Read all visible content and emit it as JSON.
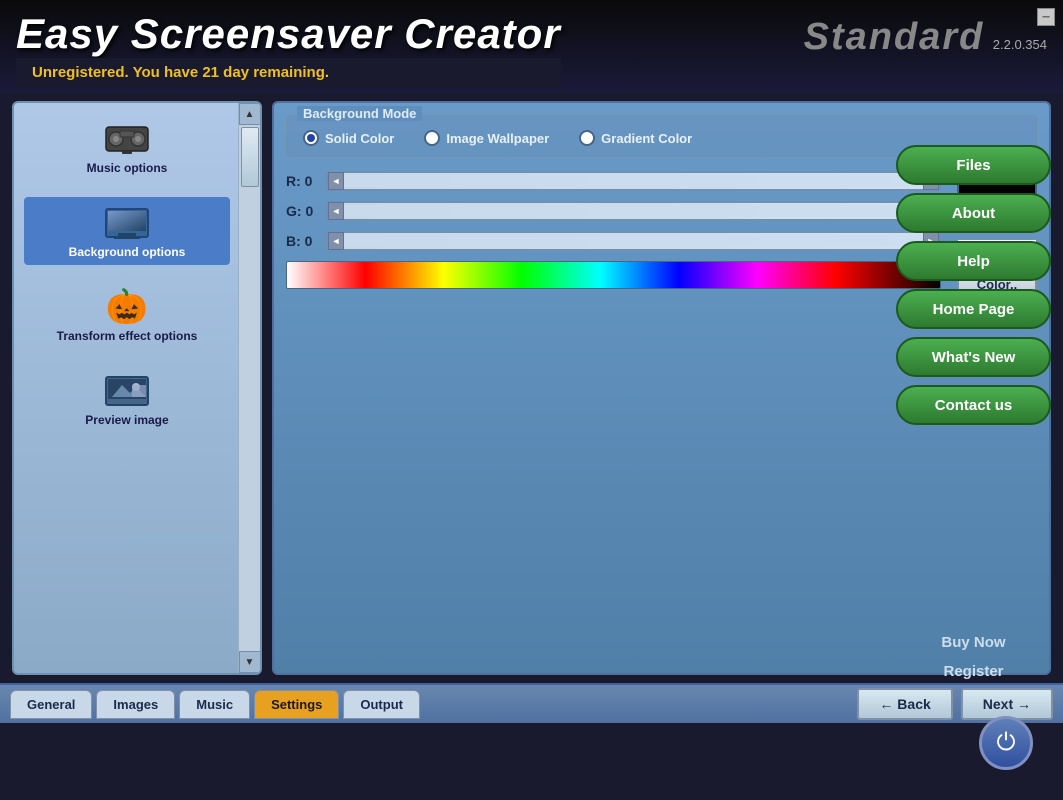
{
  "app": {
    "title": "Easy Screensaver Creator",
    "edition": "Standard",
    "version": "2.2.0.354",
    "unregistered_msg": "Unregistered. You have 21 day remaining."
  },
  "sidebar": {
    "items": [
      {
        "id": "music",
        "label": "Music options",
        "active": false
      },
      {
        "id": "background",
        "label": "Background options",
        "active": true
      },
      {
        "id": "transform",
        "label": "Transform effect options",
        "active": false
      },
      {
        "id": "preview",
        "label": "Preview image",
        "active": false
      }
    ]
  },
  "background_mode": {
    "legend": "Background Mode",
    "options": [
      {
        "id": "solid",
        "label": "Solid Color",
        "selected": true
      },
      {
        "id": "image",
        "label": "Image Wallpaper",
        "selected": false
      },
      {
        "id": "gradient",
        "label": "Gradient Color",
        "selected": false
      }
    ]
  },
  "rgb": {
    "r_label": "R: 0",
    "g_label": "G: 0",
    "b_label": "B: 0",
    "r_value": "0",
    "g_value": "0",
    "b_value": "0",
    "hex_value": "000000",
    "color_btn_label": "Color.."
  },
  "right_sidebar": {
    "buttons": [
      {
        "id": "files",
        "label": "Files"
      },
      {
        "id": "about",
        "label": "About"
      },
      {
        "id": "help",
        "label": "Help"
      },
      {
        "id": "homepage",
        "label": "Home Page"
      },
      {
        "id": "whatsnew",
        "label": "What's New"
      },
      {
        "id": "contact",
        "label": "Contact us"
      }
    ],
    "buy_now": "Buy Now",
    "register": "Register"
  },
  "tabs": [
    {
      "id": "general",
      "label": "General",
      "active": false
    },
    {
      "id": "images",
      "label": "Images",
      "active": false
    },
    {
      "id": "music",
      "label": "Music",
      "active": false
    },
    {
      "id": "settings",
      "label": "Settings",
      "active": true
    },
    {
      "id": "output",
      "label": "Output",
      "active": false
    }
  ],
  "nav": {
    "back_label": "← Back",
    "next_label": "Next →"
  }
}
